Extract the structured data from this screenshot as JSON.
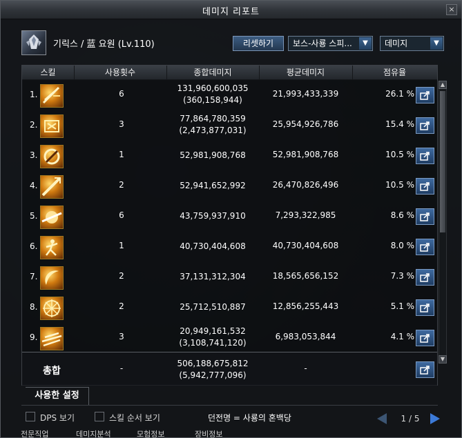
{
  "window": {
    "title": "데미지 리포트",
    "close_label": "×"
  },
  "character": {
    "name": "기릭스 / 蓝 요원 (Lv.110)"
  },
  "controls": {
    "reset_label": "리셋하기",
    "boss_select": "보스-사룡 스피...",
    "metric_select": "데미지"
  },
  "table": {
    "headers": [
      "스킬",
      "사용횟수",
      "종합데미지",
      "평균데미지",
      "점유율"
    ],
    "rows": [
      {
        "rank": "1.",
        "uses": "6",
        "total": "131,960,600,035",
        "total_sub": "(360,158,944)",
        "avg": "21,993,433,339",
        "pct": "26.1 %",
        "icon": "sword-slash-skill-icon"
      },
      {
        "rank": "2.",
        "uses": "3",
        "total": "77,864,780,359",
        "total_sub": "(2,473,877,031)",
        "avg": "25,954,926,786",
        "pct": "15.4 %",
        "icon": "calligraphy-burst-skill-icon"
      },
      {
        "rank": "3.",
        "uses": "1",
        "total": "52,981,908,768",
        "total_sub": "",
        "avg": "52,981,908,768",
        "pct": "10.5 %",
        "icon": "fire-ring-skill-icon"
      },
      {
        "rank": "4.",
        "uses": "2",
        "total": "52,941,652,992",
        "total_sub": "",
        "avg": "26,470,826,496",
        "pct": "10.5 %",
        "icon": "spear-thrust-skill-icon"
      },
      {
        "rank": "5.",
        "uses": "6",
        "total": "43,759,937,910",
        "total_sub": "",
        "avg": "7,293,322,985",
        "pct": "8.6 %",
        "icon": "orb-slash-skill-icon"
      },
      {
        "rank": "6.",
        "uses": "1",
        "total": "40,730,404,608",
        "total_sub": "",
        "avg": "40,730,404,608",
        "pct": "8.0 %",
        "icon": "warrior-leap-skill-icon"
      },
      {
        "rank": "7.",
        "uses": "2",
        "total": "37,131,312,304",
        "total_sub": "",
        "avg": "18,565,656,152",
        "pct": "7.3 %",
        "icon": "crescent-blade-skill-icon"
      },
      {
        "rank": "8.",
        "uses": "2",
        "total": "25,712,510,887",
        "total_sub": "",
        "avg": "12,856,255,443",
        "pct": "5.1 %",
        "icon": "sun-wheel-skill-icon"
      },
      {
        "rank": "9.",
        "uses": "3",
        "total": "20,949,161,532",
        "total_sub": "(3,108,741,120)",
        "avg": "6,983,053,844",
        "pct": "4.1 %",
        "icon": "light-streak-skill-icon"
      }
    ],
    "total": {
      "label": "총합",
      "uses": "-",
      "total": "506,188,675,812",
      "total_sub": "(5,942,777,096)",
      "avg": "-"
    }
  },
  "used_settings_tab": "사용한 설정",
  "bottom": {
    "dps_label": "DPS 보기",
    "skill_order_label": "스킬 순서 보기",
    "legend": "던전명 = 사룡의 혼백당",
    "page": "1 / 5"
  },
  "bottom_tabs": [
    "전문직업",
    "데미지분석",
    "모험정보",
    "장비정보"
  ],
  "colors": {
    "accent": "#3c7ad8",
    "header": "#3a3f46",
    "icon_gold": "#d07a10"
  }
}
